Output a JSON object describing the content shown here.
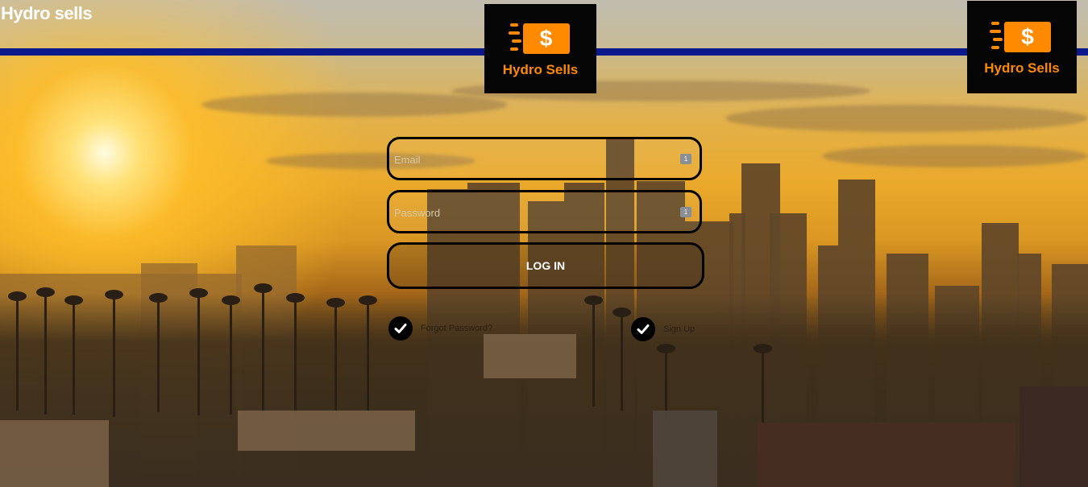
{
  "app": {
    "title": "Hydro sells"
  },
  "logo": {
    "card_symbol": "$",
    "text": "Hydro Sells"
  },
  "form": {
    "email_placeholder": "Email",
    "password_placeholder": "Password",
    "password_manager_badge": "1",
    "login_label": "LOG IN"
  },
  "links": {
    "forgot": "Forgot Password?",
    "signup": "Sign Up"
  },
  "colors": {
    "accent_orange": "#ff8a00",
    "top_rule_blue": "#0a1a8a",
    "logo_background": "#050505"
  }
}
